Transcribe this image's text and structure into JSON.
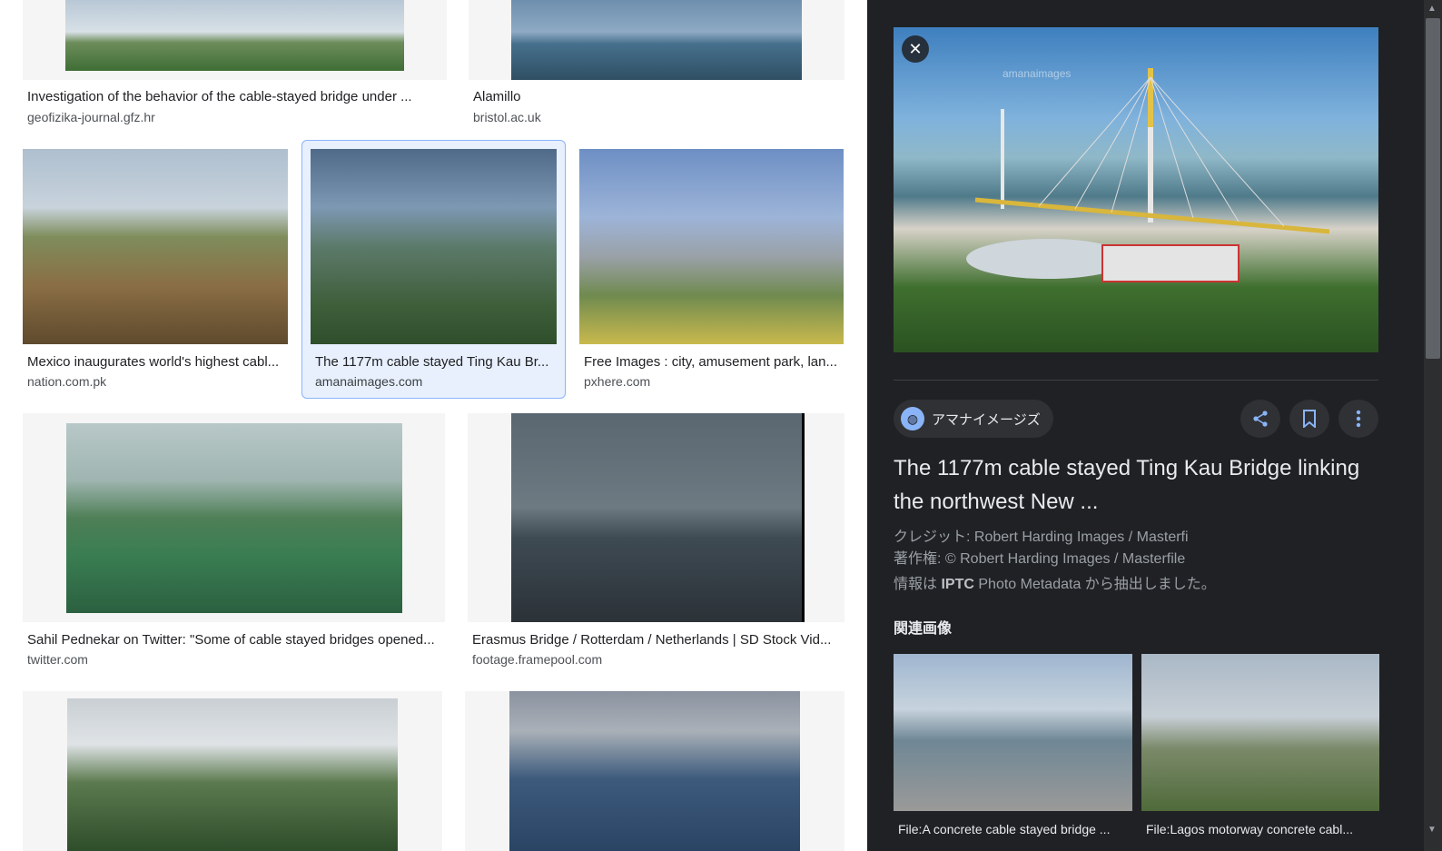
{
  "results": [
    {
      "title": "Investigation of the behavior of the cable-stayed bridge under ...",
      "source": "geofizika-journal.gfz.hr"
    },
    {
      "title": "Alamillo",
      "source": "bristol.ac.uk"
    },
    {
      "title": "Mexico inaugurates world's highest cabl...",
      "source": "nation.com.pk"
    },
    {
      "title": "The 1177m cable stayed Ting Kau Br...",
      "source": "amanaimages.com"
    },
    {
      "title": "Free Images : city, amusement park, lan...",
      "source": "pxhere.com"
    },
    {
      "title": "Sahil Pednekar on Twitter: \"Some of cable stayed bridges opened...",
      "source": "twitter.com"
    },
    {
      "title": "Erasmus Bridge / Rotterdam / Netherlands | SD Stock Vid...",
      "source": "footage.framepool.com"
    }
  ],
  "panel": {
    "close_icon": "close-icon",
    "source_chip_label": "アマナイメージズ",
    "title": "The 1177m cable stayed Ting Kau Bridge linking the northwest New ...",
    "credit": "クレジット: Robert Harding Images / Masterfi",
    "copyright": "著作権: © Robert Harding Images / Masterfile",
    "metadata_prefix": "情報は",
    "metadata_bold": "IPTC",
    "metadata_suffix": "Photo Metadata から抽出しました。",
    "related_heading": "関連画像",
    "related": [
      {
        "caption": "File:A concrete cable stayed bridge ..."
      },
      {
        "caption": "File:Lagos motorway concrete cabl..."
      }
    ],
    "watermark": "amanaimages"
  },
  "colors": {
    "selected_bg": "#e8f0fe",
    "selected_border": "#8ab4f8",
    "panel_bg": "#202124",
    "accent": "#8ab4f8"
  }
}
